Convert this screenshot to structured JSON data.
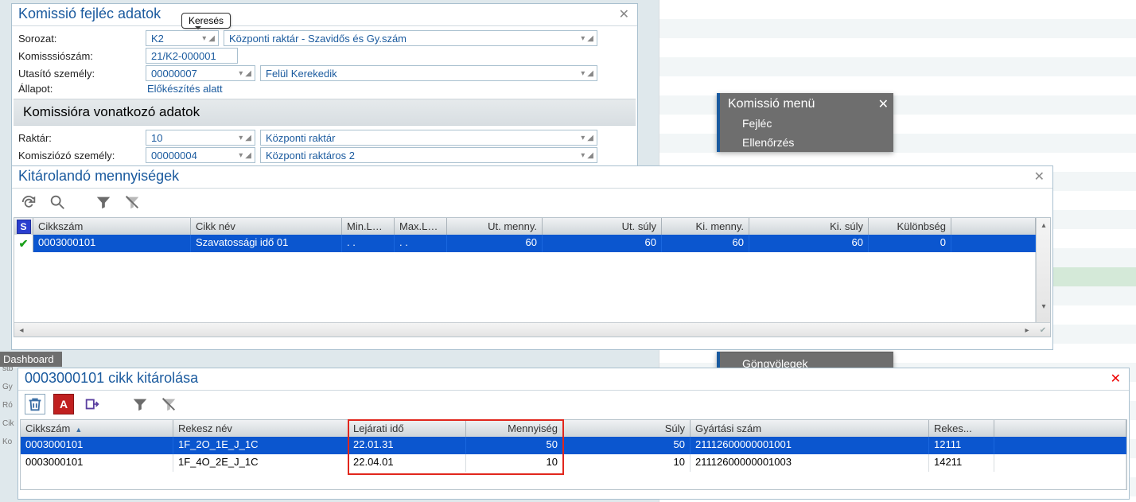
{
  "tooltip_search": "Keresés",
  "hdr_panel": {
    "title": "Komissió fejléc adatok",
    "rows": {
      "series_label": "Sorozat:",
      "series_code": "K2",
      "series_desc": "Központi raktár - Szavidős és Gy.szám",
      "comnum_label": "Komisssiószám:",
      "comnum": "21/K2-000001",
      "instr_label": "Utasító személy:",
      "instr_code": "00000007",
      "instr_name": "Felül Kerekedik",
      "state_label": "Állapot:",
      "state": "Előkészítés alatt"
    },
    "section": "Komissióra vonatkozó adatok",
    "rows2": {
      "wh_label": "Raktár:",
      "wh_code": "10",
      "wh_name": "Központi raktár",
      "picker_label": "Komisziózó személy:",
      "picker_code": "00000004",
      "picker_name": "Központi raktáros 2"
    }
  },
  "ctx": {
    "title": "Komissió menü",
    "items": [
      "Fejléc",
      "Ellenőrzés"
    ],
    "foot": "Göngyölegek"
  },
  "qty_panel": {
    "title": "Kitárolandó mennyiségek",
    "cols": [
      "S",
      "Cikkszám",
      "Cikk név",
      "Min.L…",
      "Max.L…",
      "Ut. menny.",
      "Ut. súly",
      "Ki. menny.",
      "Ki. súly",
      "Különbség"
    ],
    "row": {
      "item": "0003000101",
      "name": "Szavatossági idő 01",
      "min": ". .",
      "max": ". .",
      "utm": "60",
      "uts": "60",
      "kim": "60",
      "kis": "60",
      "diff": "0"
    }
  },
  "pick_panel": {
    "title": "0003000101 cikk kitárolása",
    "cols": [
      "Cikkszám",
      "Rekesz név",
      "Lejárati idő",
      "Mennyiség",
      "Súly",
      "Gyártási szám",
      "Rekes..."
    ],
    "rows": [
      {
        "item": "0003000101",
        "bin": "1F_2O_1E_J_1C",
        "exp": "22.01.31",
        "qty": "50",
        "w": "50",
        "batch": "21112600000001001",
        "rek": "12111"
      },
      {
        "item": "0003000101",
        "bin": "1F_4O_2E_J_1C",
        "exp": "22.04.01",
        "qty": "10",
        "w": "10",
        "batch": "21112600000001003",
        "rek": "14211"
      }
    ]
  },
  "left_tabs": [
    "stb",
    "Gy",
    "Ró",
    "Cik",
    "Ko"
  ],
  "footer_word": "Dashboard"
}
